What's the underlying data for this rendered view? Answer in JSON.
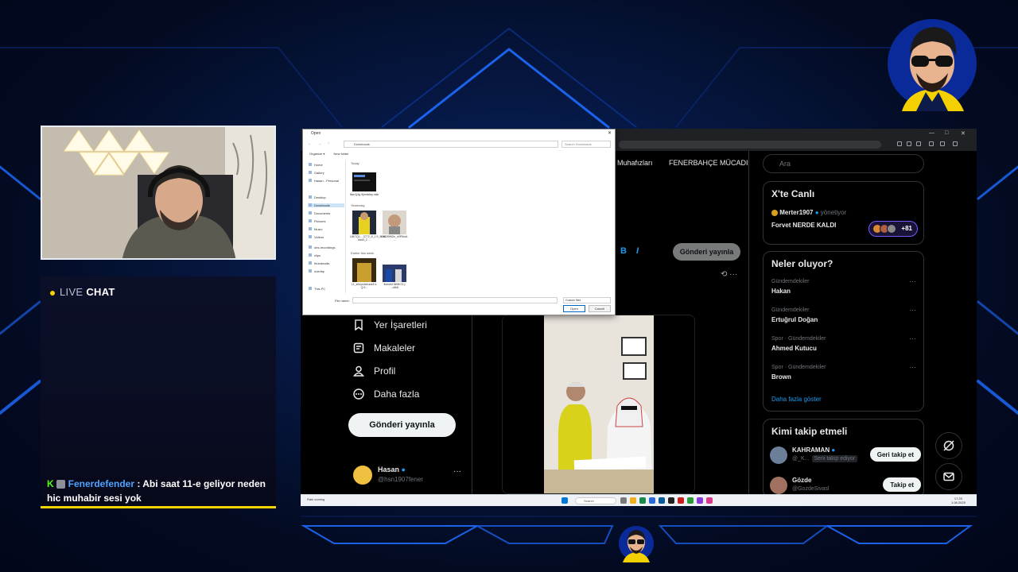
{
  "colors": {
    "accent_blue": "#1d9bf0",
    "kick_green": "#53fc18",
    "chat_yellow": "#f5d400",
    "username_blue": "#4da3ff"
  },
  "chat": {
    "live_label": "LIVE",
    "chat_label": "CHAT",
    "kick_icon": "K",
    "message": {
      "username": "Fenerdefender",
      "separator": ":",
      "text": "Abi saat 11-e geliyor neden hic muhabir sesi yok"
    }
  },
  "x": {
    "tabs": [
      "çe Muhafızları",
      "FENERBAHÇE MÜCADI"
    ],
    "format": {
      "bold": "B",
      "italic": "I"
    },
    "center_post_button": "Gönderi yayınla",
    "center_more": "···",
    "nav": [
      {
        "label": "Yer İşaretleri",
        "icon": "bookmark-icon"
      },
      {
        "label": "Makaleler",
        "icon": "article-icon"
      },
      {
        "label": "Profil",
        "icon": "profile-icon"
      },
      {
        "label": "Daha fazla",
        "icon": "more-circle-icon"
      }
    ],
    "post_button": "Gönderi yayınla",
    "profile": {
      "name": "Hasan",
      "handle": "@hsn1907fener",
      "more": "···"
    },
    "search_placeholder": "Ara",
    "live": {
      "title": "X'te Canlı",
      "host": "Merter1907",
      "host_suffix": "yönetiyor",
      "topic": "Forvet NERDE KALDI",
      "count": "+81"
    },
    "trends": {
      "title": "Neler oluyor?",
      "more_icon": "···",
      "items": [
        {
          "context": "Gündemdekiler",
          "name": "Hakan"
        },
        {
          "context": "Gündemdekiler",
          "name": "Ertuğrul Doğan"
        },
        {
          "context": "Spor · Gündemdekiler",
          "name": "Ahmed Kutucu"
        },
        {
          "context": "Spor · Gündemdekiler",
          "name": "Brown"
        }
      ],
      "show_more": "Daha fazla göster"
    },
    "who_to_follow": {
      "title": "Kimi takip etmeli",
      "items": [
        {
          "name": "KAHRAMAN",
          "handle": "@_K...",
          "follows_you": "Seni takip ediyor",
          "button": "Geri takip et"
        },
        {
          "name": "Gözde",
          "handle": "@GozdeSivasl",
          "follows_you": "",
          "button": "Takip et"
        }
      ]
    }
  },
  "dialog": {
    "title": "Open",
    "close": "✕",
    "nav_arrows": "← → ↑",
    "path": "Downloads",
    "search": "Search Downloads",
    "toolbar": [
      "Organize ▾",
      "New folder"
    ],
    "sidebar": [
      {
        "label": "Home",
        "selected": false
      },
      {
        "label": "Gallery",
        "selected": false
      },
      {
        "label": "Hasan - Personal",
        "selected": false
      },
      {
        "label": "Desktop",
        "selected": false
      },
      {
        "label": "Downloads",
        "selected": true
      },
      {
        "label": "Documents",
        "selected": false
      },
      {
        "label": "Pictures",
        "selected": false
      },
      {
        "label": "Music",
        "selected": false
      },
      {
        "label": "Videos",
        "selected": false
      },
      {
        "label": "obs-recordings",
        "selected": false
      },
      {
        "label": "clips",
        "selected": false
      },
      {
        "label": "thumbnails",
        "selected": false
      },
      {
        "label": "overlay",
        "selected": false
      },
      {
        "label": "This PC",
        "selected": false
      }
    ],
    "groups": [
      "Today",
      "Yesterday",
      "Earlier this week"
    ],
    "files": [
      "lksrr1j4g.9jirmk6sy.mkb",
      "L8K7Q1-...3772_8_1.9_9090 6dd3_2 ...",
      "L4b2f9f9Ze_n9P6hdL ...",
      "L1_s0uys4a4uue4 k-Q.9...",
      "fiuhmkt.9k9th7Z-j ...d4t4l"
    ],
    "file_name_label": "File name:",
    "file_type": "Custom files",
    "open_button": "Open",
    "cancel_button": "Cancel"
  },
  "taskbar": {
    "weather": "Rain coming",
    "search": "Search",
    "time": "17:23",
    "date": "1.06.2025"
  }
}
